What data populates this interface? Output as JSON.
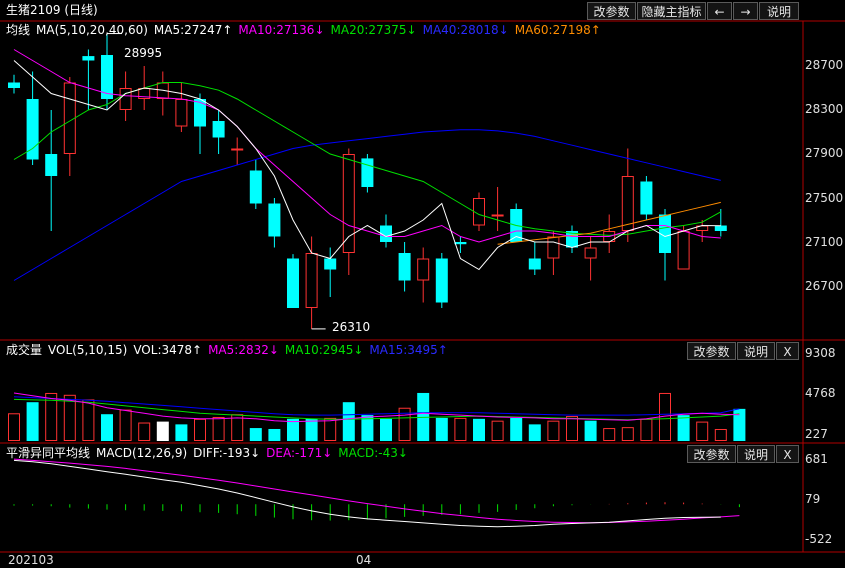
{
  "title": "生猪2109 (日线)",
  "top_buttons": [
    "改参数",
    "隐藏主指标",
    "←",
    "→",
    "说明"
  ],
  "colors": {
    "up": "#ff3232",
    "down": "#00ffff",
    "ma5": "#ffffff",
    "ma10": "#ff00ff",
    "ma20": "#00e000",
    "ma40": "#0000ff",
    "ma60": "#ff8c00",
    "axis": "#c00000",
    "tick_text": "#e0e0e0"
  },
  "main_panel": {
    "indicator": "均线",
    "params": "MA(5,10,20,40,60)",
    "items": [
      {
        "label": "MA5:27247↑",
        "color": "#ffffff"
      },
      {
        "label": "MA10:27136↓",
        "color": "#ff00ff"
      },
      {
        "label": "MA20:27375↓",
        "color": "#00e000"
      },
      {
        "label": "MA40:28018↓",
        "color": "#2a2aff"
      },
      {
        "label": "MA60:27198↑",
        "color": "#ff8c00"
      }
    ],
    "ticks": [
      "28700",
      "28300",
      "27900",
      "27500",
      "27100",
      "26700"
    ],
    "annotations": {
      "high": "28995",
      "low": "26310"
    }
  },
  "volume_panel": {
    "indicator": "成交量",
    "params": "VOL(5,10,15)",
    "items": [
      {
        "label": "VOL:3478↑",
        "color": "#ffffff"
      },
      {
        "label": "MA5:2832↓",
        "color": "#ff00ff"
      },
      {
        "label": "MA10:2945↓",
        "color": "#00e000"
      },
      {
        "label": "MA15:3495↑",
        "color": "#2a2aff"
      }
    ],
    "buttons": [
      "改参数",
      "说明",
      "X"
    ],
    "ticks": [
      "9308",
      "4768",
      "227"
    ]
  },
  "macd_panel": {
    "indicator": "平滑异同平均线",
    "params": "MACD(12,26,9)",
    "items": [
      {
        "label": "DIFF:-193↓",
        "color": "#ffffff"
      },
      {
        "label": "DEA:-171↓",
        "color": "#ff00ff"
      },
      {
        "label": "MACD:-43↓",
        "color": "#00e000"
      }
    ],
    "buttons": [
      "改参数",
      "说明",
      "X"
    ],
    "ticks": [
      "681",
      "79",
      "-522"
    ]
  },
  "x_axis": [
    "202103",
    "04"
  ],
  "chart_data": [
    {
      "type": "candlestick",
      "ylim": [
        26200,
        29200
      ],
      "ticks": [
        28700,
        28300,
        27900,
        27500,
        27100,
        26700
      ],
      "candles": [
        {
          "o": 28550,
          "h": 28620,
          "l": 28450,
          "c": 28500
        },
        {
          "o": 28400,
          "h": 28650,
          "l": 27800,
          "c": 27850
        },
        {
          "o": 27900,
          "h": 28300,
          "l": 27200,
          "c": 27700
        },
        {
          "o": 27900,
          "h": 28600,
          "l": 27700,
          "c": 28550
        },
        {
          "o": 28790,
          "h": 28850,
          "l": 28300,
          "c": 28750
        },
        {
          "o": 28800,
          "h": 28995,
          "l": 28300,
          "c": 28400
        },
        {
          "o": 28300,
          "h": 28650,
          "l": 28200,
          "c": 28500
        },
        {
          "o": 28400,
          "h": 28700,
          "l": 28300,
          "c": 28500
        },
        {
          "o": 28400,
          "h": 28650,
          "l": 28250,
          "c": 28550
        },
        {
          "o": 28150,
          "h": 28550,
          "l": 28100,
          "c": 28400
        },
        {
          "o": 28400,
          "h": 28450,
          "l": 27900,
          "c": 28150
        },
        {
          "o": 28200,
          "h": 28300,
          "l": 27900,
          "c": 28050
        },
        {
          "o": 27950,
          "h": 28050,
          "l": 27800,
          "c": 27950
        },
        {
          "o": 27750,
          "h": 27850,
          "l": 27400,
          "c": 27450
        },
        {
          "o": 27450,
          "h": 27500,
          "l": 27050,
          "c": 27150
        },
        {
          "o": 26950,
          "h": 26990,
          "l": 26500,
          "c": 26500
        },
        {
          "o": 26500,
          "h": 27150,
          "l": 26310,
          "c": 27000
        },
        {
          "o": 26950,
          "h": 27050,
          "l": 26600,
          "c": 26850
        },
        {
          "o": 27000,
          "h": 27950,
          "l": 26800,
          "c": 27900
        },
        {
          "o": 27860,
          "h": 27900,
          "l": 27550,
          "c": 27600
        },
        {
          "o": 27250,
          "h": 27350,
          "l": 27050,
          "c": 27100
        },
        {
          "o": 27000,
          "h": 27100,
          "l": 26650,
          "c": 26750
        },
        {
          "o": 26750,
          "h": 27050,
          "l": 26550,
          "c": 26950
        },
        {
          "o": 26950,
          "h": 27000,
          "l": 26500,
          "c": 26550
        },
        {
          "o": 27100,
          "h": 27150,
          "l": 27000,
          "c": 27080
        },
        {
          "o": 27250,
          "h": 27550,
          "l": 27200,
          "c": 27500
        },
        {
          "o": 27350,
          "h": 27600,
          "l": 27200,
          "c": 27350
        },
        {
          "o": 27400,
          "h": 27450,
          "l": 27100,
          "c": 27100
        },
        {
          "o": 26950,
          "h": 27100,
          "l": 26800,
          "c": 26850
        },
        {
          "o": 26950,
          "h": 27200,
          "l": 26800,
          "c": 27150
        },
        {
          "o": 27200,
          "h": 27250,
          "l": 27000,
          "c": 27050
        },
        {
          "o": 26950,
          "h": 27150,
          "l": 26750,
          "c": 27050
        },
        {
          "o": 27100,
          "h": 27350,
          "l": 27000,
          "c": 27200
        },
        {
          "o": 27200,
          "h": 27950,
          "l": 27100,
          "c": 27700
        },
        {
          "o": 27650,
          "h": 27700,
          "l": 27300,
          "c": 27350
        },
        {
          "o": 27350,
          "h": 27400,
          "l": 26750,
          "c": 27000
        },
        {
          "o": 26850,
          "h": 27250,
          "l": 26850,
          "c": 27200
        },
        {
          "o": 27200,
          "h": 27300,
          "l": 27100,
          "c": 27250
        },
        {
          "o": 27250,
          "h": 27400,
          "l": 27150,
          "c": 27200
        }
      ],
      "ma5": [
        28750,
        28600,
        28450,
        28400,
        28350,
        28300,
        28450,
        28500,
        28480,
        28450,
        28400,
        28300,
        28150,
        27950,
        27700,
        27300,
        27000,
        26950,
        27150,
        27250,
        27150,
        27200,
        27300,
        27450,
        26950,
        26850,
        27050,
        27150,
        27100,
        27100,
        27050,
        27100,
        27100,
        27200,
        27250,
        27150,
        27200,
        27250,
        27247
      ],
      "ma10": [
        28850,
        28750,
        28650,
        28550,
        28500,
        28450,
        28430,
        28420,
        28410,
        28400,
        28370,
        28300,
        28150,
        27950,
        27800,
        27650,
        27500,
        27350,
        27250,
        27200,
        27150,
        27150,
        27200,
        27250,
        27150,
        27100,
        27150,
        27200,
        27200,
        27180,
        27150,
        27150,
        27150,
        27200,
        27250,
        27250,
        27200,
        27150,
        27136
      ],
      "ma20": [
        27850,
        27950,
        28100,
        28200,
        28300,
        28350,
        28450,
        28500,
        28550,
        28550,
        28520,
        28480,
        28400,
        28300,
        28200,
        28100,
        28000,
        27900,
        27850,
        27800,
        27750,
        27700,
        27650,
        27550,
        27450,
        27350,
        27300,
        27250,
        27220,
        27200,
        27180,
        27170,
        27160,
        27170,
        27200,
        27230,
        27250,
        27280,
        27375
      ],
      "ma40": [
        26750,
        26850,
        26950,
        27050,
        27150,
        27250,
        27350,
        27450,
        27550,
        27650,
        27700,
        27750,
        27800,
        27850,
        27900,
        27950,
        27980,
        28000,
        28020,
        28040,
        28060,
        28080,
        28100,
        28110,
        28120,
        28120,
        28110,
        28090,
        28060,
        28020,
        27980,
        27940,
        27900,
        27860,
        27820,
        27780,
        27740,
        27700,
        27660
      ],
      "ma60": [
        null,
        null,
        null,
        null,
        null,
        null,
        null,
        null,
        null,
        null,
        null,
        null,
        null,
        null,
        null,
        null,
        null,
        null,
        null,
        null,
        null,
        null,
        null,
        null,
        null,
        null,
        27080,
        27100,
        27120,
        27140,
        27160,
        27180,
        27220,
        27260,
        27300,
        27340,
        27380,
        27420,
        27460
      ]
    },
    {
      "type": "bar",
      "name": "volume",
      "ylim": [
        0,
        9308
      ],
      "ticks": [
        9308,
        4768,
        227
      ],
      "values": [
        3000,
        4200,
        5200,
        5000,
        4500,
        2900,
        3400,
        2000,
        2100,
        1800,
        2400,
        2600,
        2900,
        1400,
        1300,
        2400,
        2400,
        2500,
        4200,
        2800,
        2400,
        3600,
        5200,
        2500,
        2500,
        2400,
        2200,
        2500,
        1800,
        2200,
        2700,
        2200,
        1400,
        1500,
        2400,
        5200,
        2800,
        2100,
        1300,
        3478
      ],
      "up": [
        true,
        false,
        true,
        true,
        true,
        false,
        true,
        true,
        true,
        false,
        true,
        true,
        true,
        false,
        false,
        false,
        false,
        true,
        false,
        false,
        false,
        true,
        false,
        false,
        true,
        false,
        true,
        false,
        false,
        true,
        true,
        false,
        true,
        true,
        true,
        true,
        false,
        true,
        true,
        false
      ],
      "ma5": [
        5200,
        4900,
        4600,
        4400,
        4100,
        3600,
        3300,
        3000,
        2700,
        2500,
        2400,
        2400,
        2500,
        2400,
        2200,
        2100,
        2150,
        2200,
        2400,
        2600,
        2700,
        2800,
        3000,
        2900,
        2800,
        2700,
        2600,
        2550,
        2500,
        2400,
        2400,
        2350,
        2300,
        2250,
        2400,
        2700,
        2900,
        3000,
        2900,
        2832
      ],
      "ma10": [
        4500,
        4450,
        4400,
        4300,
        4200,
        4000,
        3800,
        3600,
        3400,
        3200,
        3000,
        2900,
        2800,
        2700,
        2600,
        2500,
        2400,
        2350,
        2350,
        2400,
        2450,
        2500,
        2550,
        2600,
        2650,
        2700,
        2650,
        2600,
        2550,
        2500,
        2450,
        2400,
        2350,
        2300,
        2350,
        2400,
        2500,
        2600,
        2700,
        2945
      ],
      "ma15": [
        4800,
        4700,
        4600,
        4500,
        4400,
        4300,
        4150,
        4000,
        3850,
        3700,
        3550,
        3400,
        3250,
        3100,
        2950,
        2850,
        2800,
        2800,
        2850,
        2900,
        2950,
        3000,
        3050,
        3050,
        3050,
        3050,
        3000,
        2950,
        2900,
        2850,
        2800,
        2800,
        2800,
        2800,
        2850,
        2900,
        2950,
        3000,
        3050,
        3495
      ]
    },
    {
      "type": "line",
      "name": "macd",
      "ylim": [
        -700,
        800
      ],
      "ticks": [
        681,
        79,
        -522
      ],
      "diff": [
        660,
        640,
        610,
        570,
        530,
        490,
        450,
        410,
        370,
        330,
        280,
        230,
        170,
        100,
        30,
        -40,
        -100,
        -150,
        -190,
        -220,
        -240,
        -260,
        -280,
        -300,
        -320,
        -330,
        -340,
        -330,
        -320,
        -300,
        -290,
        -280,
        -270,
        -250,
        -230,
        -210,
        -200,
        -195,
        -193
      ],
      "dea": [
        680,
        660,
        640,
        620,
        595,
        570,
        540,
        505,
        470,
        435,
        400,
        360,
        320,
        275,
        230,
        185,
        140,
        95,
        50,
        10,
        -30,
        -70,
        -105,
        -140,
        -170,
        -200,
        -225,
        -245,
        -260,
        -270,
        -275,
        -278,
        -275,
        -265,
        -255,
        -240,
        -225,
        -205,
        -190,
        -171
      ],
      "hist": [
        -20,
        -20,
        -30,
        -50,
        -65,
        -80,
        -90,
        -95,
        -100,
        -105,
        -120,
        -130,
        -150,
        -175,
        -200,
        -225,
        -240,
        -245,
        -240,
        -230,
        -210,
        -190,
        -175,
        -160,
        -150,
        -130,
        -115,
        -85,
        -60,
        -30,
        -15,
        -2,
        5,
        15,
        25,
        30,
        25,
        10,
        -3,
        -43
      ]
    }
  ]
}
